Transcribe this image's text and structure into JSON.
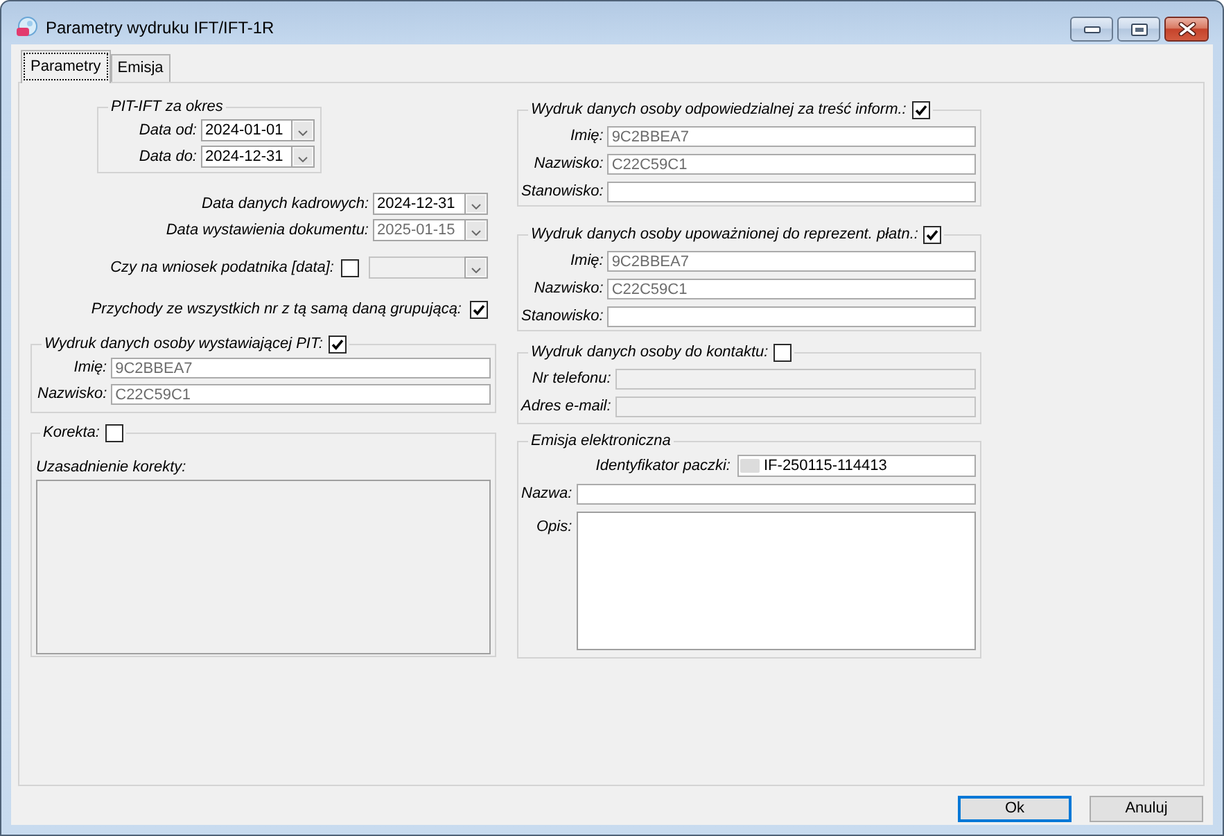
{
  "window": {
    "title": "Parametry wydruku IFT/IFT-1R"
  },
  "tabs": [
    {
      "label": "Parametry",
      "selected": true
    },
    {
      "label": "Emisja",
      "selected": false
    }
  ],
  "period": {
    "legend": "PIT-IFT za okres",
    "fields": [
      {
        "label": "Data od:",
        "value": "2024-01-01",
        "readonly": false
      },
      {
        "label": "Data do:",
        "value": "2024-12-31",
        "readonly": false
      }
    ]
  },
  "document_dates": [
    {
      "label": "Data danych kadrowych:",
      "value": "2024-12-31",
      "readonly": false
    },
    {
      "label": "Data wystawienia dokumentu:",
      "value": "2025-01-15",
      "readonly": true
    }
  ],
  "on_request": {
    "label": "Czy na wniosek podatnika [data]:",
    "checked": false,
    "date_disabled": true
  },
  "grouping": {
    "label": "Przychody ze wszystkich nr z tą samą daną grupującą:",
    "checked": true
  },
  "issuer": {
    "legend": "Wydruk danych osoby wystawiającej PIT:",
    "checked": true,
    "fields": [
      {
        "label": "Imię:",
        "value": "9C2BBEA7",
        "readonly": true,
        "disabled": false
      },
      {
        "label": "Nazwisko:",
        "value": "C22C59C1",
        "readonly": true,
        "disabled": false
      }
    ]
  },
  "correction": {
    "legend": "Korekta:",
    "checked": false,
    "reason_label": "Uzasadnienie korekty:",
    "reason_disabled": true
  },
  "persons": [
    {
      "legend": "Wydruk danych osoby odpowiedzialnej za treść inform.:",
      "checked": true,
      "fields": [
        {
          "label": "Imię:",
          "value": "9C2BBEA7",
          "readonly": true,
          "disabled": false
        },
        {
          "label": "Nazwisko:",
          "value": "C22C59C1",
          "readonly": true,
          "disabled": false
        },
        {
          "label": "Stanowisko:",
          "disabled": false
        }
      ]
    },
    {
      "legend": "Wydruk danych osoby upoważnionej do reprezent. płatn.:",
      "checked": true,
      "fields": [
        {
          "label": "Imię:",
          "value": "9C2BBEA7",
          "readonly": true,
          "disabled": false
        },
        {
          "label": "Nazwisko:",
          "value": "C22C59C1",
          "readonly": true,
          "disabled": false
        },
        {
          "label": "Stanowisko:",
          "disabled": false
        }
      ]
    },
    {
      "legend": "Wydruk danych osoby do kontaktu:",
      "checked": false,
      "fields": [
        {
          "label": "Nr telefonu:",
          "disabled": true
        },
        {
          "label": "Adres e-mail:",
          "disabled": true
        }
      ]
    }
  ],
  "e_emission": {
    "legend": "Emisja elektroniczna",
    "package_id": {
      "label": "Identyfikator paczki:",
      "value": "IF-250115-114413"
    },
    "name": {
      "label": "Nazwa:"
    },
    "description": {
      "label": "Opis:"
    }
  },
  "buttons": [
    {
      "label": "Ok",
      "default": true
    },
    {
      "label": "Anuluj",
      "default": false
    }
  ]
}
